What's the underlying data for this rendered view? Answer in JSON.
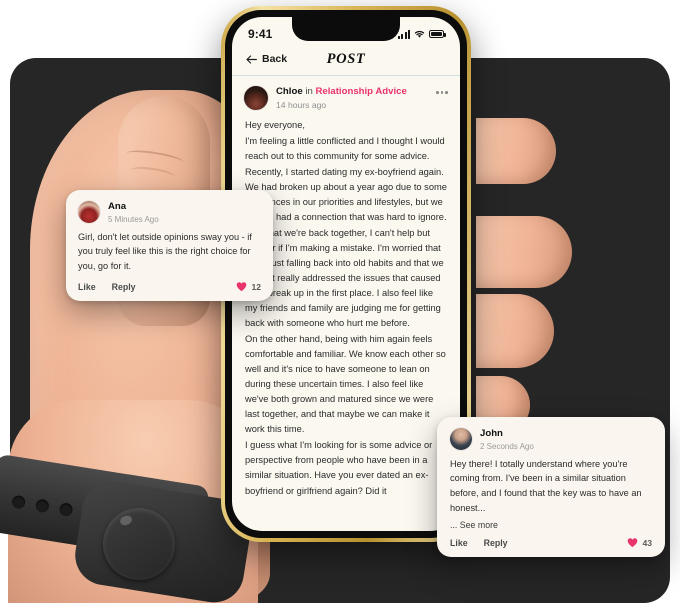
{
  "phone": {
    "status_bar": {
      "time": "9:41",
      "signal_icon": "signal-bars-icon",
      "wifi_icon": "wifi-icon",
      "battery_icon": "battery-icon"
    },
    "nav": {
      "back_label": "Back",
      "back_icon": "arrow-left-icon",
      "title": "POST",
      "menu_icon": "more-horizontal-icon"
    },
    "post": {
      "author": "Chloe",
      "in_label": "in",
      "topic": "Relationship Advice",
      "topic_color": "#e8336d",
      "timestamp": "14 hours ago",
      "avatar": "chloe-avatar",
      "paragraphs": [
        "Hey everyone,",
        "I'm feeling a little conflicted and I thought I would reach out to this community for some advice. Recently, I started dating my ex-boyfriend again. We had broken up about a year ago due to some differences in our priorities and lifestyles, but we always had a connection that was hard to ignore.",
        "Now that we're back together, I can't help but wonder if I'm making a mistake. I'm worried that we're just falling back into old habits and that we haven't really addressed the issues that caused us to break up in the first place. I also feel like my friends and family are judging me for getting back with someone who hurt me before.",
        "On the other hand, being with him again feels comfortable and familiar. We know each other so well and it's nice to have someone to lean on during these uncertain times. I also feel like we've both grown and matured since we were last together, and that maybe we can make it work this time.",
        "I guess what I'm looking for is some advice or perspective from people who have been in a similar situation. Have you ever dated an ex-boyfriend or girlfriend again? Did it"
      ]
    }
  },
  "comments": [
    {
      "id": "ana",
      "author": "Ana",
      "timestamp": "5 Minutes Ago",
      "avatar": "ana-avatar",
      "text": "Girl, don't let outside opinions sway you - if you truly feel like this is the right choice for you, go for it.",
      "see_more": null,
      "like_label": "Like",
      "reply_label": "Reply",
      "likes": "12",
      "heart_icon": "heart-icon"
    },
    {
      "id": "john",
      "author": "John",
      "timestamp": "2 Seconds Ago",
      "avatar": "john-avatar",
      "text": "Hey there! I totally understand where you're coming from. I've been in a similar situation before, and I found that the key was to have an honest...",
      "see_more": "... See more",
      "like_label": "Like",
      "reply_label": "Reply",
      "likes": "43",
      "heart_icon": "heart-icon"
    }
  ],
  "scene": {
    "backdrop_color": "#262626",
    "phone_frame_color": "#d8b455",
    "screen_color": "#fbf8f0",
    "accent_color": "#e8336d",
    "hand": "hand-holding-phone",
    "watch": "smartwatch"
  }
}
